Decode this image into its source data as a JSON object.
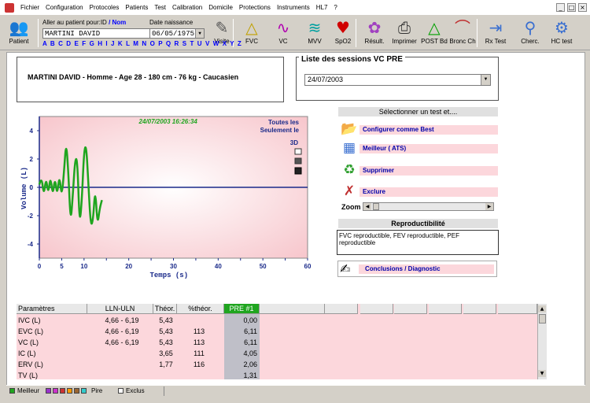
{
  "menu": [
    "Fichier",
    "Configuration",
    "Protocoles",
    "Patients",
    "Test",
    "Calibration",
    "Domicile",
    "Protections",
    "Instruments",
    "HL7",
    "?"
  ],
  "toolbar": {
    "patient": "Patient",
    "search_prefix": "Aller au patient pour:ID",
    "search_nom": "/ Nom",
    "birth_label": "Date naissance",
    "name_value": "MARTINI DAVID",
    "birth_value": "06/05/1975",
    "alphabet": "A B C D E F G H I J K L M N O P Q R S T U V W X Y Z",
    "buttons": [
      {
        "label": "Visite",
        "icon": "visit-icon",
        "glyph": "✎"
      },
      {
        "label": "FVC",
        "icon": "fvc-icon",
        "glyph": "△"
      },
      {
        "label": "VC",
        "icon": "vc-icon",
        "glyph": "∿"
      },
      {
        "label": "MVV",
        "icon": "mvv-icon",
        "glyph": "≋"
      },
      {
        "label": "SpO2",
        "icon": "heart-icon",
        "glyph": "♥"
      },
      {
        "label": "Résult.",
        "icon": "results-icon",
        "glyph": "✿"
      },
      {
        "label": "Imprimer",
        "icon": "printer-icon",
        "glyph": "⎙"
      },
      {
        "label": "POST Bd",
        "icon": "post-bd-icon",
        "glyph": "△"
      },
      {
        "label": "Bronc Ch",
        "icon": "bronc-ch-icon",
        "glyph": "⌒"
      },
      {
        "label": "Rx Test",
        "icon": "rx-test-icon",
        "glyph": "⇥"
      },
      {
        "label": "Cherc.",
        "icon": "search-icon",
        "glyph": "⚲"
      },
      {
        "label": "HC test",
        "icon": "hc-test-icon",
        "glyph": "⚙"
      }
    ]
  },
  "patient_info": "MARTINI DAVID - Homme - Age 28 - 180 cm - 76 kg - Caucasien",
  "sessions": {
    "title": "Liste des sessions  VC PRE",
    "selected": "24/07/2003"
  },
  "chart_controls": {
    "line1": "Toutes les",
    "line2": "Seulement le",
    "line3": "3D"
  },
  "chart_data": {
    "type": "line",
    "title": "24/07/2003 16:26:34",
    "xlabel": "Temps  (s)",
    "ylabel": "Volume  (L)",
    "xlim": [
      0,
      60
    ],
    "ylim": [
      -5,
      5
    ],
    "xticks": [
      0,
      5,
      10,
      15,
      20,
      25,
      30,
      35,
      40,
      45,
      50,
      55,
      60
    ],
    "yticks": [
      4,
      2,
      0,
      -2,
      -4
    ],
    "series": [
      {
        "color": "#1fa51f",
        "x": [
          0.0,
          0.5,
          1.0,
          1.5,
          2.0,
          2.5,
          3.0,
          3.5,
          4.0,
          4.5,
          5.0,
          5.5,
          6.0,
          6.5,
          7.0,
          7.5,
          8.0,
          8.5,
          9.0,
          9.5,
          10.0,
          10.5,
          11.0,
          11.5,
          12.0,
          12.5,
          13.0,
          13.5,
          14.0
        ],
        "y": [
          0.2,
          0.8,
          -0.6,
          0.7,
          -0.5,
          0.8,
          -0.6,
          0.7,
          -0.6,
          0.9,
          -0.7,
          1.0,
          3.3,
          1.0,
          -2.6,
          -0.5,
          2.0,
          2.0,
          -2.7,
          -1.0,
          2.6,
          3.0,
          0.0,
          -2.7,
          -2.4,
          0.0,
          -2.7,
          -1.5,
          -0.9
        ]
      }
    ]
  },
  "select_test_header": "Sélectionner un test et....",
  "actions": [
    {
      "label": "Configurer comme Best",
      "icon": "folder-star-icon",
      "glyph": "📂"
    },
    {
      "label": "Meilleur ( ATS)",
      "icon": "calculator-icon",
      "glyph": "▦"
    },
    {
      "label": "Supprimer",
      "icon": "recycle-bin-icon",
      "glyph": "♻"
    },
    {
      "label": "Exclure",
      "icon": "exclude-icon",
      "glyph": "✗"
    }
  ],
  "zoom_label": "Zoom",
  "repro": {
    "header": "Reproductibilité",
    "text": "FVC reproductible, FEV reproductible, PEF reproductible"
  },
  "conclusions": "Conclusions / Diagnostic",
  "table": {
    "headers": [
      "Paramètres",
      "LLN-ULN",
      "Théor.",
      "%théor.",
      "PRE #1"
    ],
    "rows": [
      [
        "IVC (L)",
        "4,66 - 6,19",
        "5,43",
        "",
        "0,00"
      ],
      [
        "EVC (L)",
        "4,66 - 6,19",
        "5,43",
        "113",
        "6,11"
      ],
      [
        "VC (L)",
        "4,66 - 6,19",
        "5,43",
        "113",
        "6,11"
      ],
      [
        "IC (L)",
        "",
        "3,65",
        "111",
        "4,05"
      ],
      [
        "ERV (L)",
        "",
        "1,77",
        "116",
        "2,06"
      ],
      [
        "TV (L)",
        "",
        "",
        "",
        "1,31"
      ]
    ]
  },
  "status": {
    "meilleur": "Meilleur",
    "pire": "Pire",
    "exclus": "Exclus",
    "legend_colors": [
      "#1fa51f",
      "#9933cc",
      "#cc33cc",
      "#cc3333",
      "#ff9900",
      "#996633",
      "#33cccc"
    ]
  }
}
